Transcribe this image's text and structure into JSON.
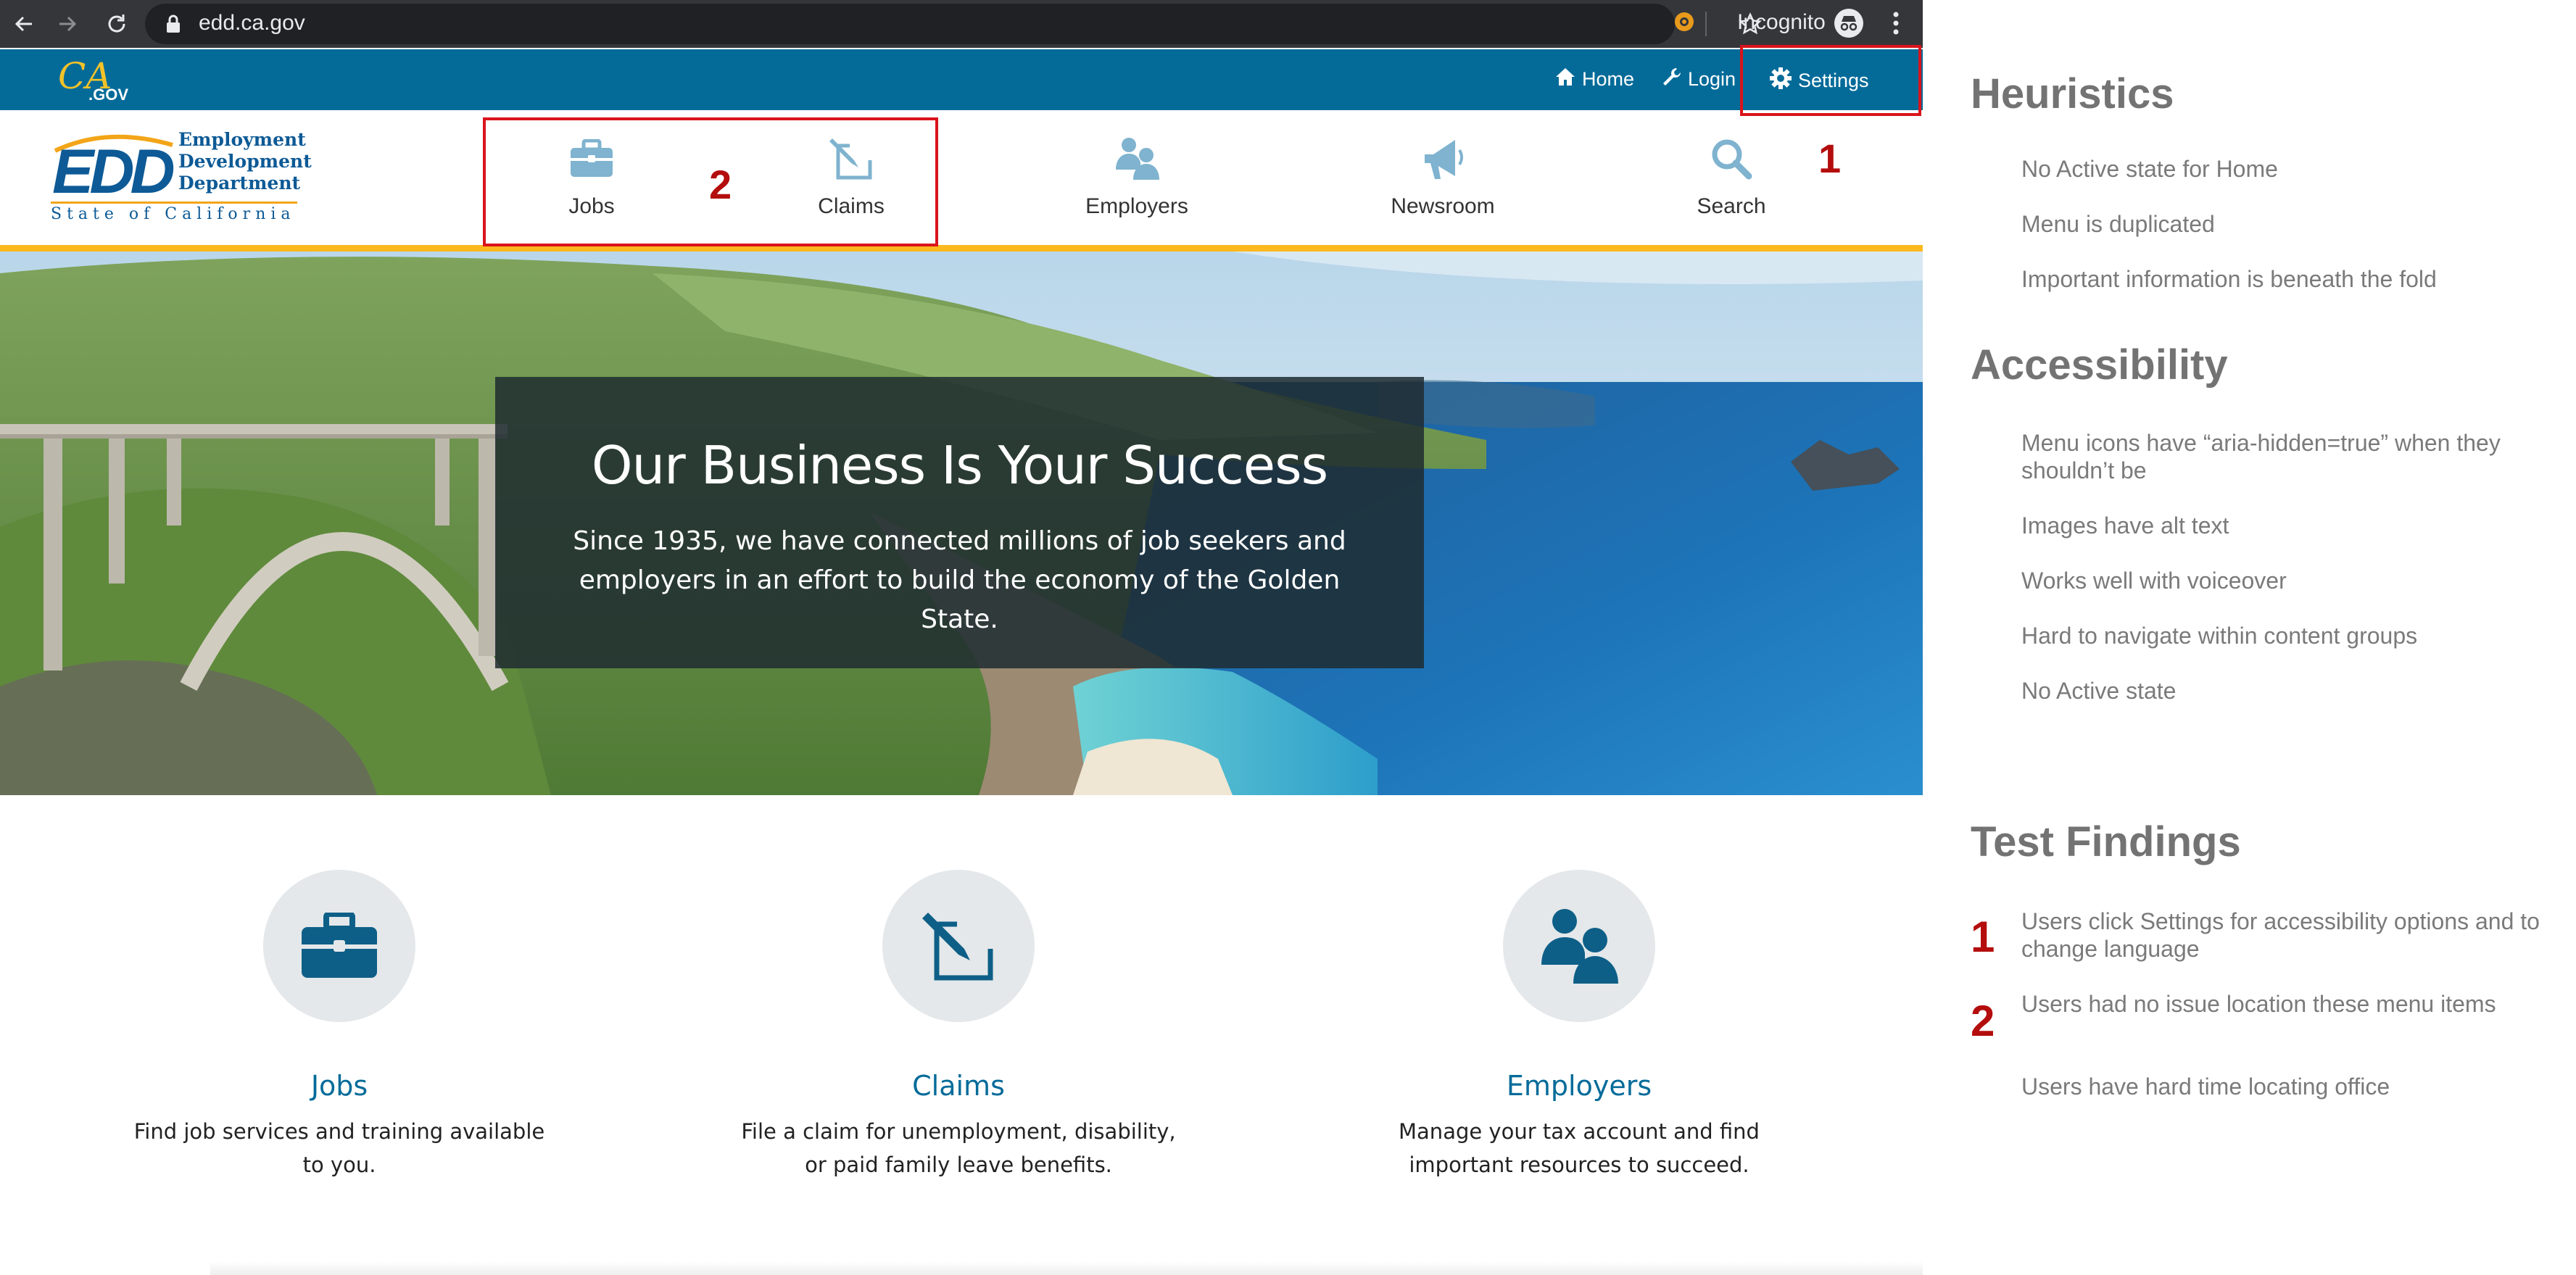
{
  "browser": {
    "url": "edd.ca.gov",
    "incognito_label": "Incognito"
  },
  "topbar": {
    "logo_text": "CA.GOV",
    "links": [
      {
        "label": "Home",
        "icon": "home-icon"
      },
      {
        "label": "Login",
        "icon": "wrench-icon"
      },
      {
        "label": "Settings",
        "icon": "gear-icon"
      }
    ]
  },
  "logo": {
    "abbr": "EDD",
    "line1": "Employment",
    "line2": "Development",
    "line3": "Department",
    "state": "State of California"
  },
  "nav": [
    {
      "label": "Jobs",
      "icon": "briefcase-icon"
    },
    {
      "label": "Claims",
      "icon": "pencil-square-icon"
    },
    {
      "label": "Employers",
      "icon": "people-icon"
    },
    {
      "label": "Newsroom",
      "icon": "megaphone-icon"
    },
    {
      "label": "Search",
      "icon": "search-icon"
    }
  ],
  "hero": {
    "title": "Our Business Is Your Success",
    "text": "Since 1935, we have connected millions of job seekers and employers in an effort to build the economy of the Golden State."
  },
  "cards": [
    {
      "title": "Jobs",
      "text": "Find job services and training available to you.",
      "icon": "briefcase-icon"
    },
    {
      "title": "Claims",
      "text": "File a claim for unemployment, disability, or paid family leave benefits.",
      "icon": "pencil-square-icon"
    },
    {
      "title": "Employers",
      "text": "Manage your tax account and find important resources to succeed.",
      "icon": "people-icon"
    }
  ],
  "annotations": {
    "marker1": "1",
    "marker2": "2"
  },
  "panel": {
    "heuristics": {
      "title": "Heuristics",
      "items": [
        "No Active state for Home",
        "Menu is duplicated",
        "Important information is beneath the fold"
      ]
    },
    "accessibility": {
      "title": "Accessibility",
      "items": [
        "Menu icons have “aria-hidden=true” when they shouldn’t be",
        "Images have alt text",
        "Works well with voiceover",
        "Hard to navigate within content groups",
        "No Active state"
      ]
    },
    "findings": {
      "title": "Test Findings",
      "items": [
        {
          "num": "1",
          "text": "Users click Settings for accessibility options and to change language"
        },
        {
          "num": "2",
          "text": "Users had no issue location these menu items"
        },
        {
          "num": "",
          "text": "Users have hard time locating office"
        }
      ]
    }
  },
  "colors": {
    "utility_bar": "#046b99",
    "accent_gold": "#fdb81e",
    "link_blue": "#046b99",
    "annotation_red": "#d9141c",
    "icon_light": "#7fb3cf",
    "icon_dark": "#0e5f87"
  }
}
